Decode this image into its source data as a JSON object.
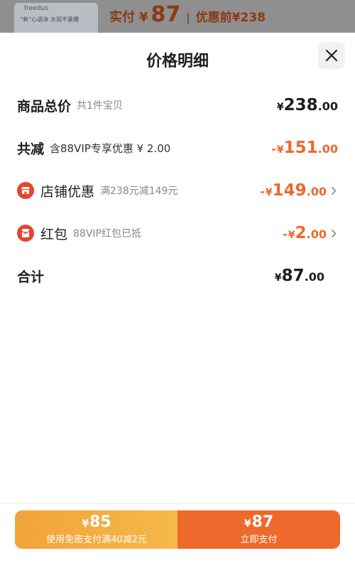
{
  "background": {
    "brand": "freedus",
    "slogan": "“新”心语净 水润不紧绷",
    "pay_label": "实付",
    "currency": "¥",
    "pay_amount": "87",
    "separator": "|",
    "original_label": "优惠前¥238"
  },
  "sheet": {
    "title": "价格明细",
    "close_icon": "close-icon"
  },
  "rows": {
    "total": {
      "name": "商品总价",
      "sub": "共1件宝贝",
      "sign": "",
      "yen": "¥",
      "int": "238",
      "dec": ".00"
    },
    "reduce": {
      "name": "共减",
      "sub": "含88VIP专享优惠 ¥ 2.00",
      "sign": "-",
      "yen": "¥",
      "int": "151",
      "dec": ".00"
    },
    "shop": {
      "icon": "shop-icon",
      "name": "店铺优惠",
      "sub": "满238元减149元",
      "sign": "-",
      "yen": "¥",
      "int": "149",
      "dec": ".00"
    },
    "redpack": {
      "icon": "red-packet-icon",
      "name": "红包",
      "sub": "88VIP红包已抵",
      "sign": "-",
      "yen": "¥",
      "int": "2",
      "dec": ".00"
    },
    "sum": {
      "name": "合计",
      "yen": "¥",
      "int": "87",
      "dec": ".00"
    }
  },
  "buttons": {
    "left": {
      "yen": "¥",
      "amount": "85",
      "label": "使用免密支付满40减2元"
    },
    "right": {
      "yen": "¥",
      "amount": "87",
      "label": "立即支付"
    }
  },
  "colors": {
    "accent": "#ee6a2c",
    "accent_light": "#f2a33a",
    "icon_red": "#e8432e"
  }
}
